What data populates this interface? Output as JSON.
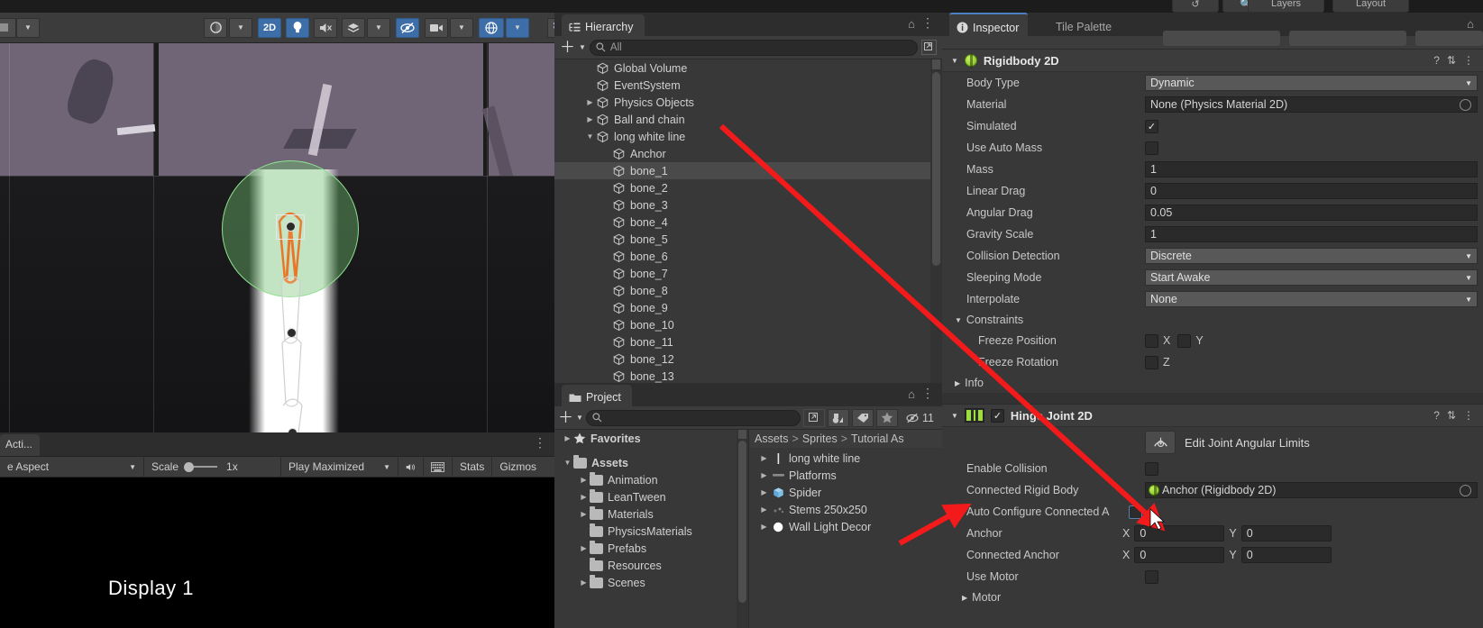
{
  "app": {
    "title": "Unity Editor"
  },
  "topbar": {
    "buttons": [
      {
        "name": "collab-icon",
        "label": "↺"
      },
      {
        "name": "search-icon",
        "label": "🔍"
      },
      {
        "name": "layers-dropdown",
        "label": "Layers"
      },
      {
        "name": "layout-dropdown",
        "label": "Layout"
      }
    ]
  },
  "scene": {
    "toolbar": {
      "handle_label": "",
      "shading_label": "",
      "two_d_label": "2D",
      "light_label": "",
      "audio_label": "",
      "fx_label": "",
      "visibility_label": "",
      "camera_label": "",
      "gizmos_label": "",
      "grid_label": ""
    }
  },
  "game": {
    "tab_label": "Acti...",
    "aspect_label": "e Aspect",
    "scale_label": "Scale",
    "scale_value": "1x",
    "play_mode_label": "Play Maximized",
    "mute_label": "",
    "stats_label": "Stats",
    "gizmos_label": "Gizmos",
    "display_label": "Display 1"
  },
  "hierarchy": {
    "tab_label": "Hierarchy",
    "search_placeholder": "All",
    "items": [
      {
        "label": "Global Volume",
        "indent": 1,
        "arrow": "",
        "selected": false
      },
      {
        "label": "EventSystem",
        "indent": 1,
        "arrow": "",
        "selected": false
      },
      {
        "label": "Physics Objects",
        "indent": 1,
        "arrow": "▶",
        "selected": false
      },
      {
        "label": "Ball and chain",
        "indent": 1,
        "arrow": "▶",
        "selected": false
      },
      {
        "label": "long white line",
        "indent": 1,
        "arrow": "▼",
        "selected": false
      },
      {
        "label": "Anchor",
        "indent": 2,
        "arrow": "",
        "selected": false
      },
      {
        "label": "bone_1",
        "indent": 2,
        "arrow": "",
        "selected": true
      },
      {
        "label": "bone_2",
        "indent": 2,
        "arrow": "",
        "selected": false
      },
      {
        "label": "bone_3",
        "indent": 2,
        "arrow": "",
        "selected": false
      },
      {
        "label": "bone_4",
        "indent": 2,
        "arrow": "",
        "selected": false
      },
      {
        "label": "bone_5",
        "indent": 2,
        "arrow": "",
        "selected": false
      },
      {
        "label": "bone_6",
        "indent": 2,
        "arrow": "",
        "selected": false
      },
      {
        "label": "bone_7",
        "indent": 2,
        "arrow": "",
        "selected": false
      },
      {
        "label": "bone_8",
        "indent": 2,
        "arrow": "",
        "selected": false
      },
      {
        "label": "bone_9",
        "indent": 2,
        "arrow": "",
        "selected": false
      },
      {
        "label": "bone_10",
        "indent": 2,
        "arrow": "",
        "selected": false
      },
      {
        "label": "bone_11",
        "indent": 2,
        "arrow": "",
        "selected": false
      },
      {
        "label": "bone_12",
        "indent": 2,
        "arrow": "",
        "selected": false
      },
      {
        "label": "bone_13",
        "indent": 2,
        "arrow": "",
        "selected": false
      }
    ]
  },
  "project": {
    "tab_label": "Project",
    "search_placeholder": "",
    "visibility_count": "11",
    "tree": [
      {
        "label": "Favorites",
        "indent": 0,
        "arrow": "▶",
        "icon": "star-icon"
      },
      {
        "label": "Assets",
        "indent": 0,
        "arrow": "▼",
        "icon": "folder-icon"
      },
      {
        "label": "Animation",
        "indent": 1,
        "arrow": "▶",
        "icon": "folder-icon"
      },
      {
        "label": "LeanTween",
        "indent": 1,
        "arrow": "▶",
        "icon": "folder-icon"
      },
      {
        "label": "Materials",
        "indent": 1,
        "arrow": "▶",
        "icon": "folder-icon"
      },
      {
        "label": "PhysicsMaterials",
        "indent": 1,
        "arrow": "",
        "icon": "folder-icon"
      },
      {
        "label": "Prefabs",
        "indent": 1,
        "arrow": "▶",
        "icon": "folder-icon"
      },
      {
        "label": "Resources",
        "indent": 1,
        "arrow": "",
        "icon": "folder-icon"
      },
      {
        "label": "Scenes",
        "indent": 1,
        "arrow": "▶",
        "icon": "folder-icon"
      }
    ],
    "breadcrumb": [
      "Assets",
      "Sprites",
      "Tutorial As"
    ],
    "contents": [
      {
        "label": "long white line",
        "arrow": "▶",
        "icon": "sprite-line-icon"
      },
      {
        "label": "Platforms",
        "arrow": "▶",
        "icon": "sprite-platform-icon"
      },
      {
        "label": "Spider",
        "arrow": "▶",
        "icon": "prefab-icon"
      },
      {
        "label": "Stems 250x250",
        "arrow": "▶",
        "icon": "sprite-stems-icon"
      },
      {
        "label": "Wall Light Decor",
        "arrow": "▶",
        "icon": "light-icon"
      }
    ]
  },
  "inspector": {
    "tabs": [
      {
        "label": "Inspector",
        "active": true
      },
      {
        "label": "Tile Palette",
        "active": false
      }
    ],
    "rigidbody": {
      "title": "Rigidbody 2D",
      "rows": [
        {
          "label": "Body Type",
          "type": "dropdown",
          "value": "Dynamic"
        },
        {
          "label": "Material",
          "type": "object",
          "value": "None (Physics Material 2D)"
        },
        {
          "label": "Simulated",
          "type": "checkbox",
          "value": true
        },
        {
          "label": "Use Auto Mass",
          "type": "checkbox",
          "value": false
        },
        {
          "label": "Mass",
          "type": "text",
          "value": "1"
        },
        {
          "label": "Linear Drag",
          "type": "text",
          "value": "0"
        },
        {
          "label": "Angular Drag",
          "type": "text",
          "value": "0.05"
        },
        {
          "label": "Gravity Scale",
          "type": "text",
          "value": "1"
        },
        {
          "label": "Collision Detection",
          "type": "dropdown",
          "value": "Discrete"
        },
        {
          "label": "Sleeping Mode",
          "type": "dropdown",
          "value": "Start Awake"
        },
        {
          "label": "Interpolate",
          "type": "dropdown",
          "value": "None"
        }
      ],
      "constraints_label": "Constraints",
      "freeze_position_label": "Freeze Position",
      "freeze_position_x": "X",
      "freeze_position_y": "Y",
      "freeze_rotation_label": "Freeze Rotation",
      "freeze_rotation_z": "Z",
      "info_label": "Info"
    },
    "hinge": {
      "title": "Hinge Joint 2D",
      "enabled": true,
      "edit_button_label": "Edit Joint Angular Limits",
      "enable_collision_label": "Enable Collision",
      "enable_collision_value": false,
      "connected_rigid_body_label": "Connected Rigid Body",
      "connected_rigid_body_value": "Anchor (Rigidbody 2D)",
      "auto_configure_label": "Auto Configure Connected A",
      "auto_configure_value": false,
      "anchor_label": "Anchor",
      "anchor_x_label": "X",
      "anchor_x": "0",
      "anchor_y_label": "Y",
      "anchor_y": "0",
      "connected_anchor_label": "Connected Anchor",
      "connected_anchor_x_label": "X",
      "connected_anchor_x": "0",
      "connected_anchor_y_label": "Y",
      "connected_anchor_y": "0",
      "use_motor_label": "Use Motor",
      "use_motor_value": false,
      "motor_label": "Motor"
    }
  },
  "annotations": {
    "arrow_color": "#f21a1a"
  }
}
